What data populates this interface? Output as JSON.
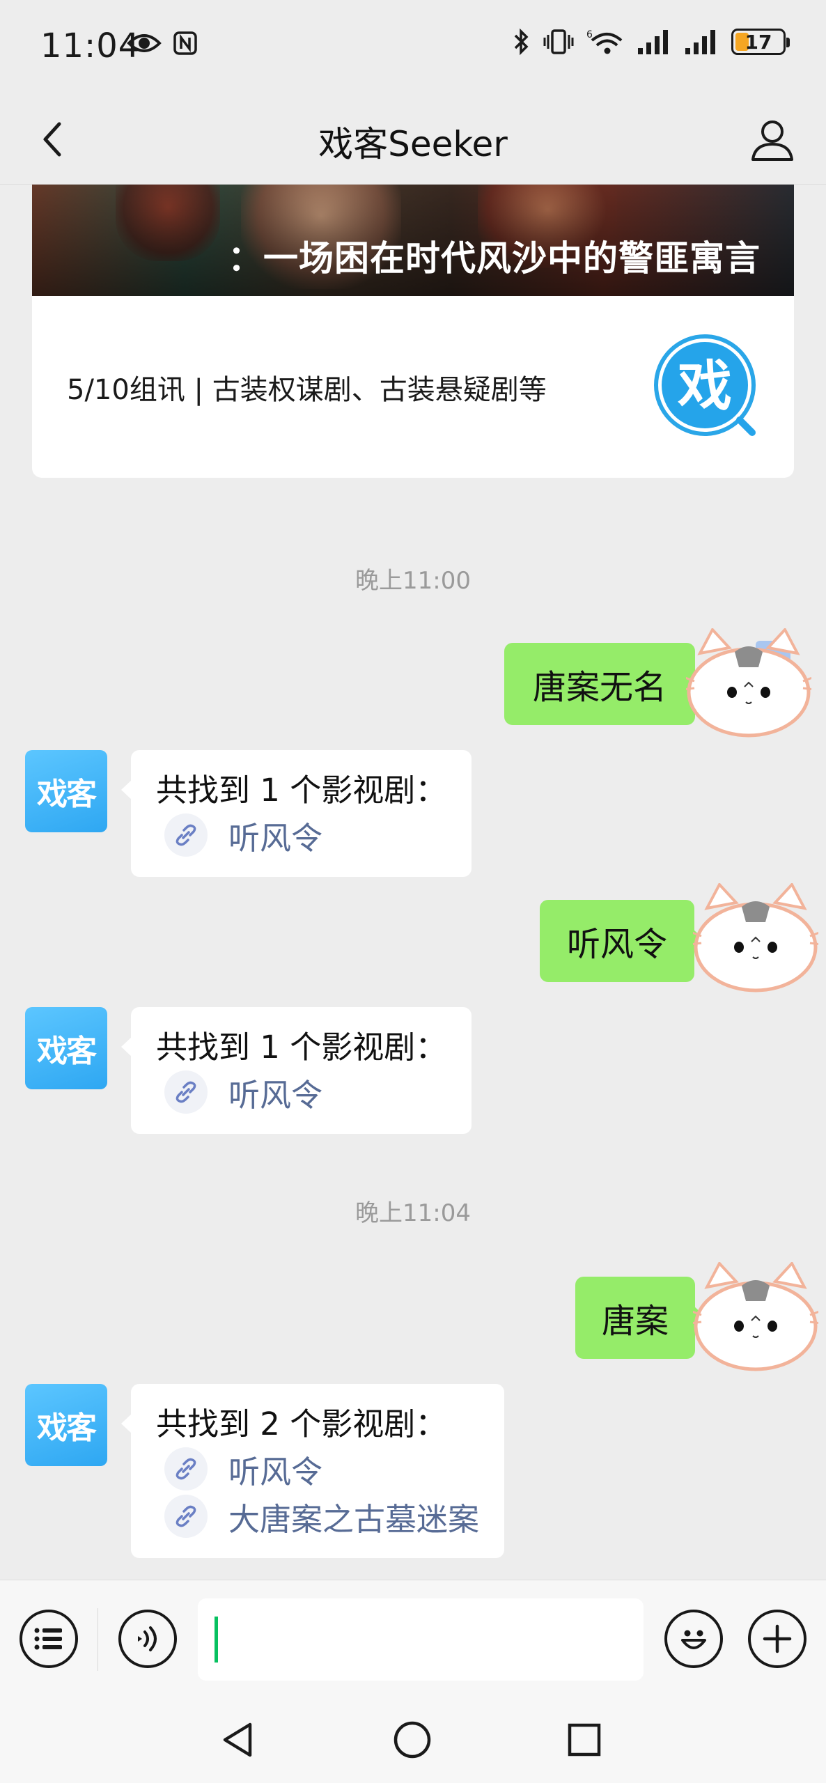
{
  "status_bar": {
    "time": "11:04",
    "battery_level": "17",
    "icons": [
      "eye-icon",
      "nfc-icon",
      "bluetooth-icon",
      "vibrate-icon",
      "wifi-icon",
      "signal-icon",
      "signal-icon",
      "battery-icon"
    ]
  },
  "nav": {
    "title": "戏客Seeker",
    "back_icon": "chevron-left-icon",
    "profile_icon": "person-icon"
  },
  "article": {
    "cover_caption": "：一场困在时代风沙中的警匪寓言",
    "subtitle": "5/10组讯 | 古装权谋剧、古装悬疑剧等",
    "logo_char": "戏"
  },
  "messages": {
    "ts1": "晚上11:00",
    "out1": "唐案无名",
    "in1_heading": "共找到 1 个影视剧：",
    "in1_link1": "听风令",
    "out2": "听风令",
    "in2_heading": "共找到 1 个影视剧：",
    "in2_link1": "听风令",
    "ts2": "晚上11:04",
    "out3": "唐案",
    "in3_heading": "共找到 2 个影视剧：",
    "in3_link1": "听风令",
    "in3_link2": "大唐案之古墓迷案"
  },
  "bot": {
    "avatar_text": "戏客"
  },
  "input_bar": {
    "value": "",
    "icons": [
      "menu-list-icon",
      "voice-icon",
      "emoji-icon",
      "plus-icon"
    ]
  },
  "colors": {
    "outgoing_bubble": "#95ec69",
    "link_text": "#576b95",
    "bot_avatar": "#2ea7f2",
    "background": "#ededed"
  }
}
